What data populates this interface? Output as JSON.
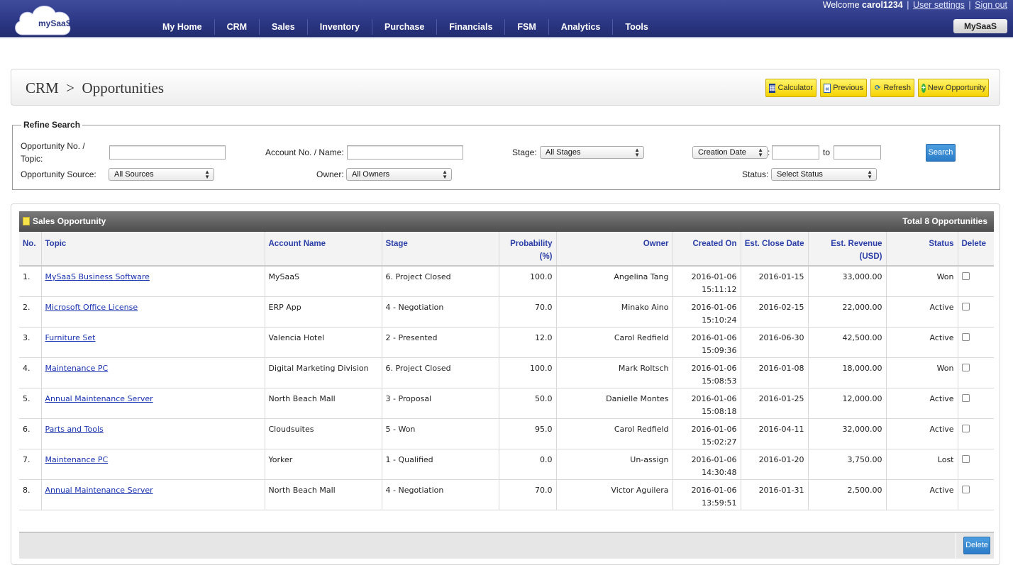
{
  "header": {
    "logo_text": "mySaaS",
    "nav": [
      "My Home",
      "CRM",
      "Sales",
      "Inventory",
      "Purchase",
      "Financials",
      "FSM",
      "Analytics",
      "Tools"
    ],
    "welcome_prefix": "Welcome",
    "username": "carol1234",
    "user_settings": "User settings",
    "separator": "|",
    "sign_out": "Sign out",
    "app_button": "MySaaS"
  },
  "title": {
    "breadcrumb": "CRM  >  Opportunities",
    "buttons": {
      "calculator": "Calculator",
      "previous": "Previous",
      "refresh": "Refresh",
      "new_opportunity": "New Opportunity"
    }
  },
  "search": {
    "legend": "Refine Search",
    "opportunity_no_label_1": "Opportunity No. /",
    "opportunity_no_label_2": "Topic:",
    "account_label": "Account No. / Name:",
    "stage_label": "Stage:",
    "stage_value": "All Stages",
    "date_field": "Creation Date",
    "colon": ":",
    "to_label": "to",
    "source_label": "Opportunity Source:",
    "source_value": "All Sources",
    "owner_label": "Owner:",
    "owner_value": "All Owners",
    "status_label": "Status:",
    "status_value": "Select Status",
    "search_button": "Search"
  },
  "grid": {
    "title": "Sales Opportunity",
    "total": "Total 8 Opportunities",
    "columns": {
      "no": "No.",
      "topic": "Topic",
      "account": "Account Name",
      "stage": "Stage",
      "probability_1": "Probability",
      "probability_2": "(%)",
      "owner": "Owner",
      "created": "Created On",
      "close": "Est. Close Date",
      "revenue_1": "Est. Revenue",
      "revenue_2": "(USD)",
      "status": "Status",
      "delete": "Delete"
    },
    "rows": [
      {
        "no": "1.",
        "topic": "MySaaS Business Software",
        "account": "MySaaS",
        "stage": "6. Project Closed",
        "probability": "100.0",
        "owner": "Angelina Tang",
        "created_date": "2016-01-06",
        "created_time": "15:11:12",
        "close": "2016-01-15",
        "revenue": "33,000.00",
        "status": "Won"
      },
      {
        "no": "2.",
        "topic": "Microsoft Office License",
        "account": "ERP App",
        "stage": "4 - Negotiation",
        "probability": "70.0",
        "owner": "Minako Aino",
        "created_date": "2016-01-06",
        "created_time": "15:10:24",
        "close": "2016-02-15",
        "revenue": "22,000.00",
        "status": "Active"
      },
      {
        "no": "3.",
        "topic": "Furniture Set",
        "account": "Valencia Hotel",
        "stage": "2 - Presented",
        "probability": "12.0",
        "owner": "Carol Redfield",
        "created_date": "2016-01-06",
        "created_time": "15:09:36",
        "close": "2016-06-30",
        "revenue": "42,500.00",
        "status": "Active"
      },
      {
        "no": "4.",
        "topic": "Maintenance PC",
        "account": "Digital Marketing Division",
        "stage": "6. Project Closed",
        "probability": "100.0",
        "owner": "Mark Roltsch",
        "created_date": "2016-01-06",
        "created_time": "15:08:53",
        "close": "2016-01-08",
        "revenue": "18,000.00",
        "status": "Won"
      },
      {
        "no": "5.",
        "topic": "Annual Maintenance Server",
        "account": "North Beach Mall",
        "stage": "3 - Proposal",
        "probability": "50.0",
        "owner": "Danielle Montes",
        "created_date": "2016-01-06",
        "created_time": "15:08:18",
        "close": "2016-01-25",
        "revenue": "12,000.00",
        "status": "Active"
      },
      {
        "no": "6.",
        "topic": "Parts and Tools",
        "account": "Cloudsuites",
        "stage": "5 - Won",
        "probability": "95.0",
        "owner": "Carol Redfield",
        "created_date": "2016-01-06",
        "created_time": "15:02:27",
        "close": "2016-04-11",
        "revenue": "32,000.00",
        "status": "Active"
      },
      {
        "no": "7.",
        "topic": "Maintenance PC",
        "account": "Yorker",
        "stage": "1 - Qualified",
        "probability": "0.0",
        "owner": "Un-assign",
        "created_date": "2016-01-06",
        "created_time": "14:30:48",
        "close": "2016-01-20",
        "revenue": "3,750.00",
        "status": "Lost"
      },
      {
        "no": "8.",
        "topic": "Annual Maintenance Server",
        "account": "North Beach Mall",
        "stage": "4 - Negotiation",
        "probability": "70.0",
        "owner": "Victor Aguilera",
        "created_date": "2016-01-06",
        "created_time": "13:59:51",
        "close": "2016-01-31",
        "revenue": "2,500.00",
        "status": "Active"
      }
    ],
    "delete_button": "Delete"
  },
  "icons": {
    "logo": "cloud-logo-icon",
    "calculator": "calculator-icon",
    "previous": "double-chevron-left-icon",
    "refresh": "refresh-icon",
    "new": "plus-circle-icon",
    "grid": "notepad-icon",
    "select": "updown-arrows-icon"
  },
  "colors": {
    "nav_bar": "#2c3784",
    "link": "#1a33b0",
    "button_yellow": "#f5d200",
    "button_blue": "#2b7cc9",
    "grid_header": "#5c5c5c"
  }
}
